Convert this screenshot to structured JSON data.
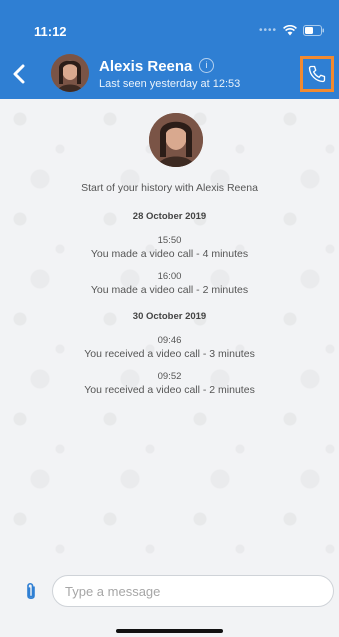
{
  "status_bar": {
    "time": "11:12",
    "signal_icon": "cellular-dots-icon",
    "wifi_icon": "wifi-icon",
    "battery_icon": "battery-icon"
  },
  "header": {
    "back_icon": "chevron-left-icon",
    "contact_name": "Alexis Reena",
    "info_symbol": "i",
    "last_seen": "Last seen yesterday at 12:53",
    "call_icon": "phone-icon",
    "background_color": "#2f7fd3",
    "highlight_color": "#f28a30"
  },
  "chat": {
    "history_start": "Start of your history with Alexis Reena",
    "groups": [
      {
        "date": "28 October 2019",
        "events": [
          {
            "time": "15:50",
            "text": "You made a video call - 4 minutes"
          },
          {
            "time": "16:00",
            "text": "You made a video call - 2 minutes"
          }
        ]
      },
      {
        "date": "30 October 2019",
        "events": [
          {
            "time": "09:46",
            "text": "You received a video call - 3 minutes"
          },
          {
            "time": "09:52",
            "text": "You received a video call - 2 minutes"
          }
        ]
      }
    ]
  },
  "input": {
    "attach_icon": "paperclip-icon",
    "placeholder": "Type a message",
    "value": ""
  }
}
